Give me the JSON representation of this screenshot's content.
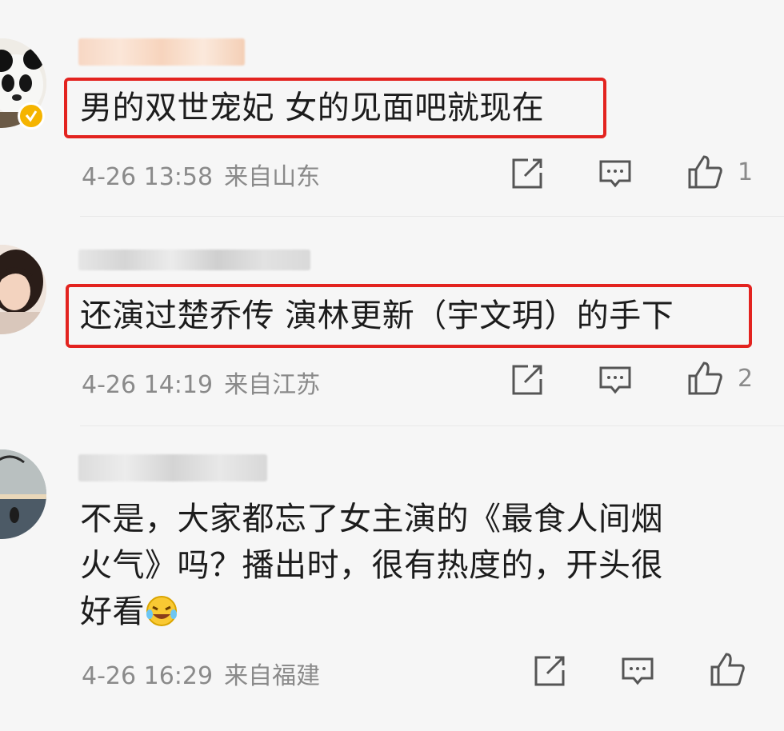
{
  "comments": [
    {
      "text_lines": [
        "男的双世宠妃 女的见面吧就现在"
      ],
      "date": "4-26 13:58",
      "location": "来自山东",
      "likes": "1",
      "highlighted": true,
      "verified_badge": true,
      "avatar_icon": "panda-avatar"
    },
    {
      "text_lines": [
        "还演过楚乔传  演林更新（宇文玥）的手下"
      ],
      "date": "4-26 14:19",
      "location": "来自江苏",
      "likes": "2",
      "highlighted": true,
      "verified_badge": false,
      "avatar_icon": "girl-avatar"
    },
    {
      "text_lines": [
        "不是，大家都忘了女主演的《最食人间烟",
        "火气》吗？播出时，很有热度的，开头很",
        "好看"
      ],
      "date": "4-26 16:29",
      "location": "来自福建",
      "likes": "",
      "highlighted": false,
      "verified_badge": false,
      "avatar_icon": "sunset-avatar",
      "trailing_emoji": "laugh-cry-emoji"
    }
  ],
  "icons": {
    "repost": "repost-icon",
    "comment": "comment-icon",
    "like": "thumbs-up-icon"
  },
  "colors": {
    "highlight_border": "#e3231f",
    "meta_text": "#8a8a8a",
    "verified_badge": "#f5b400"
  }
}
